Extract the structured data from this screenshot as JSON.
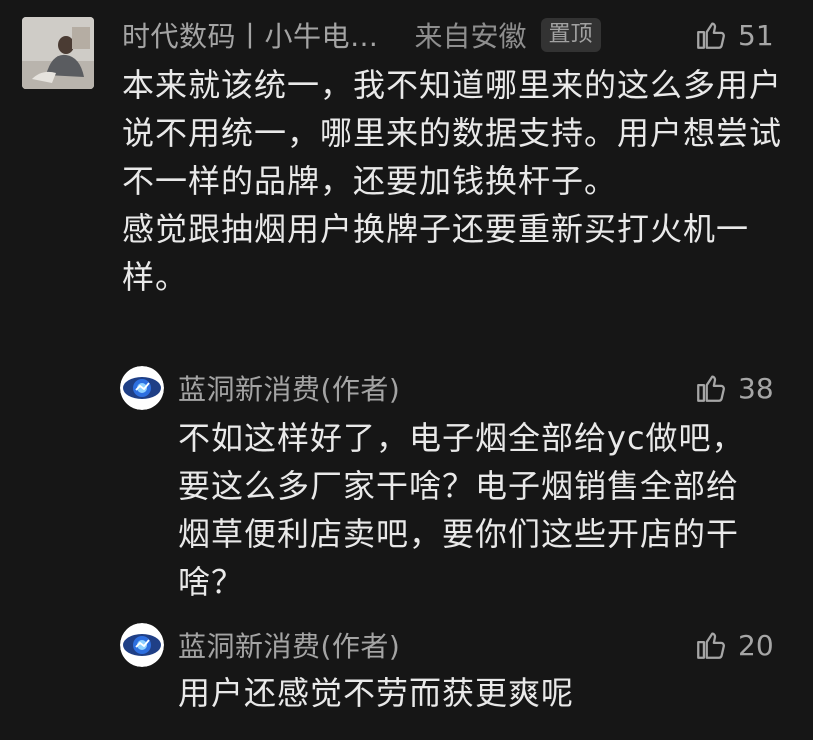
{
  "top_comment": {
    "author": "时代数码丨小牛电…",
    "location": "来自安徽",
    "badge": "置顶",
    "likes": "51",
    "paragraphs": [
      "本来就该统一，我不知道哪里来的这么多用户说不用统一，哪里来的数据支持。用户想尝试不一样的品牌，还要加钱换杆子。",
      "感觉跟抽烟用户换牌子还要重新买打火机一样。"
    ]
  },
  "replies": [
    {
      "author": "蓝洞新消费(作者)",
      "likes": "38",
      "text": "不如这样好了，电子烟全部给yc做吧，要这么多厂家干啥？电子烟销售全部给烟草便利店卖吧，要你们这些开店的干啥？"
    },
    {
      "author": "蓝洞新消费(作者)",
      "likes": "20",
      "text": "用户还感觉不劳而获更爽呢"
    }
  ],
  "icons": {
    "like": "thumbs-up-icon",
    "avatar_reply": "blue-eye-logo"
  },
  "colors": {
    "background": "#161616",
    "text": "#e9e9e9",
    "meta": "#a4a4a4",
    "badge_bg": "#333333",
    "logo_blue": "#2d6fe0"
  }
}
